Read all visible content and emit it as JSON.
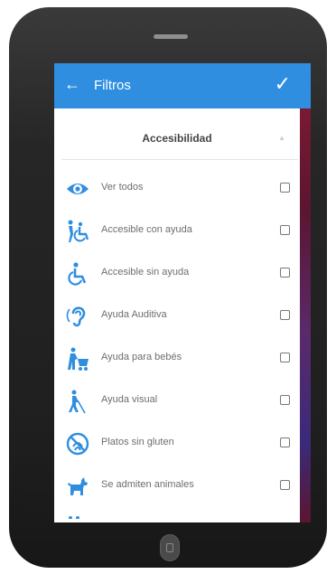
{
  "appbar": {
    "back_icon": "arrow-left-icon",
    "title": "Filtros",
    "confirm_icon": "check-icon",
    "color": "#2f8ee0"
  },
  "section": {
    "title": "Accesibilidad",
    "chevron_icon": "chevron-up-icon"
  },
  "filters": [
    {
      "label": "Ver todos",
      "icon": "eye-icon",
      "checked": false
    },
    {
      "label": "Accesible con ayuda",
      "icon": "assisted-wheelchair-icon",
      "checked": false
    },
    {
      "label": "Accesible sin ayuda",
      "icon": "wheelchair-icon",
      "checked": false
    },
    {
      "label": "Ayuda Auditiva",
      "icon": "hearing-icon",
      "checked": false
    },
    {
      "label": "Ayuda para bebés",
      "icon": "baby-stroller-icon",
      "checked": false
    },
    {
      "label": "Ayuda visual",
      "icon": "blind-cane-icon",
      "checked": false
    },
    {
      "label": "Platos sin gluten",
      "icon": "gluten-free-icon",
      "checked": false
    },
    {
      "label": "Se admiten animales",
      "icon": "dog-icon",
      "checked": false
    }
  ],
  "icon_color": "#2f8ee0"
}
